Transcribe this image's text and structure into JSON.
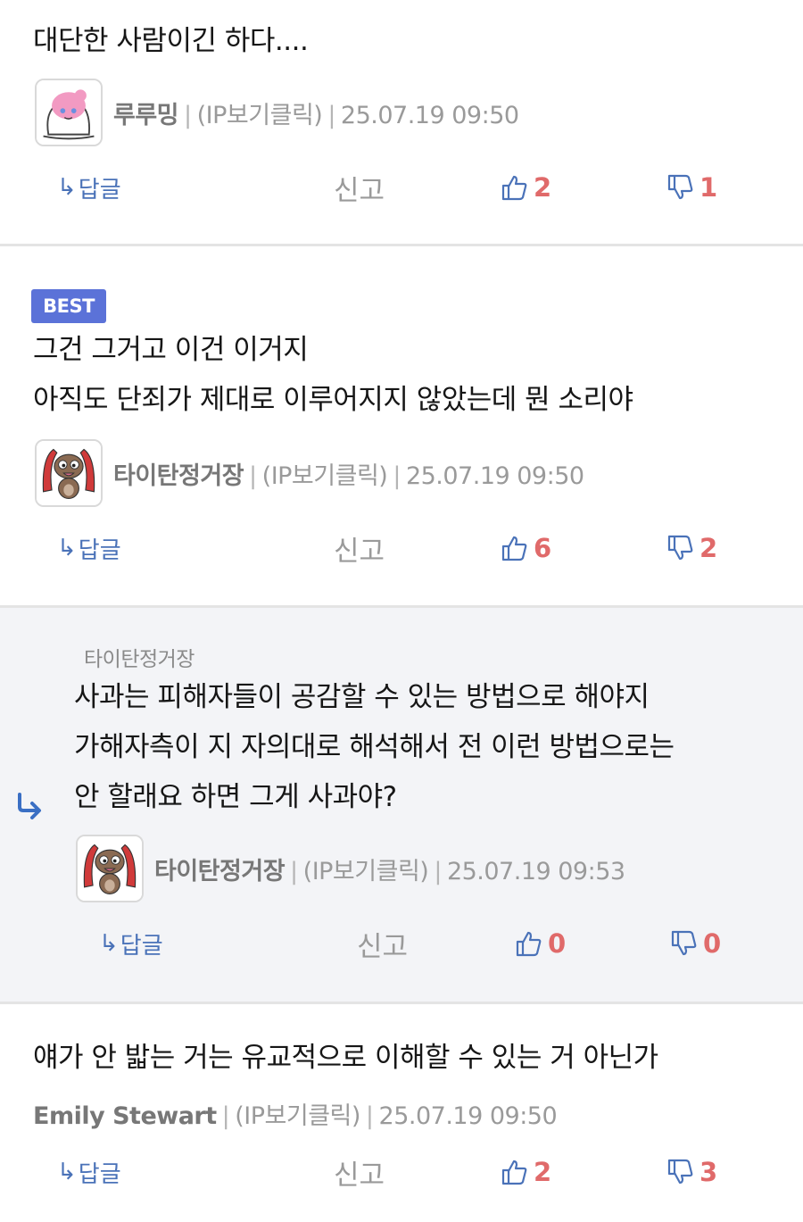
{
  "comments": [
    {
      "text": "대단한 사람이긴 하다....",
      "nickname": "루루밍",
      "ip_label": "(IP보기클릭)",
      "datetime": "25.07.19 09:50",
      "reply_label": "답글",
      "report_label": "신고",
      "likes": "2",
      "dislikes": "1",
      "avatar": "pink-hair-character-avatar"
    },
    {
      "badge": "BEST",
      "text": "그건 그거고 이건 이거지\n아직도 단죄가 제대로 이루어지지 않았는데 뭔 소리야",
      "nickname": "타이탄정거장",
      "ip_label": "(IP보기클릭)",
      "datetime": "25.07.19 09:50",
      "reply_label": "답글",
      "report_label": "신고",
      "likes": "6",
      "dislikes": "2",
      "avatar": "brown-creature-avatar"
    },
    {
      "is_reply": true,
      "reply_to": "타이탄정거장",
      "text": "사과는 피해자들이 공감할 수 있는 방법으로 해야지\n가해자측이 지 자의대로 해석해서 전 이런 방법으로는\n안 할래요 하면 그게 사과야?",
      "nickname": "타이탄정거장",
      "ip_label": "(IP보기클릭)",
      "datetime": "25.07.19 09:53",
      "reply_label": "답글",
      "report_label": "신고",
      "likes": "0",
      "dislikes": "0",
      "avatar": "brown-creature-avatar"
    },
    {
      "text": "얘가 안 밟는 거는 유교적으로 이해할 수 있는 거 아닌가",
      "nickname": "Emily Stewart",
      "ip_label": "(IP보기클릭)",
      "datetime": "25.07.19 09:50",
      "reply_label": "답글",
      "report_label": "신고",
      "likes": "2",
      "dislikes": "3"
    }
  ],
  "colors": {
    "best_badge": "#5b72d8",
    "reply_link": "#4a72b8",
    "vote_count": "#e06a6a",
    "reply_background": "#f3f4f7"
  }
}
